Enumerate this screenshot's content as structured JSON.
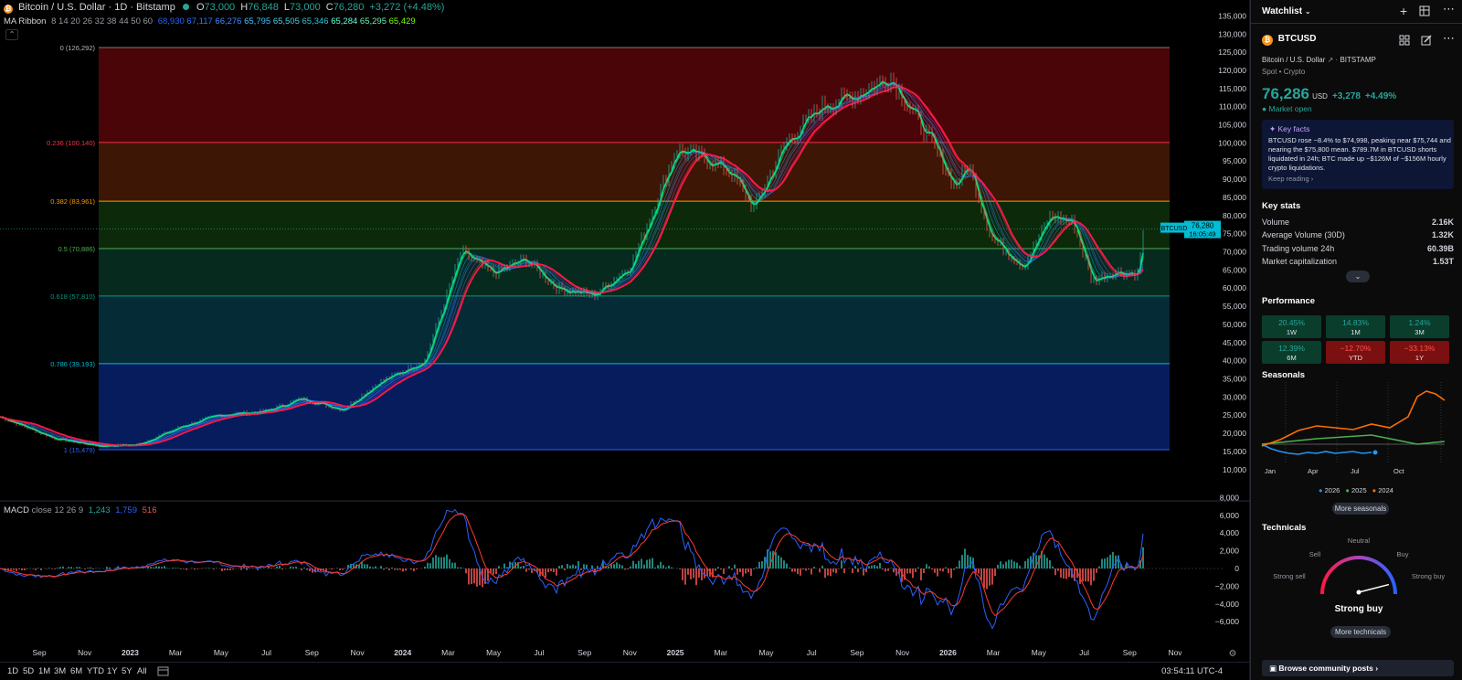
{
  "header": {
    "symbol_title": "Bitcoin / U.S. Dollar · 1D · Bitstamp",
    "ohlc": [
      {
        "label": "O",
        "value": "73,000"
      },
      {
        "label": "H",
        "value": "76,848"
      },
      {
        "label": "L",
        "value": "73,000"
      },
      {
        "label": "C",
        "value": "76,280"
      }
    ],
    "change": "+3,272 (+4.48%)",
    "ma_label": "MA Ribbon",
    "ma_params": "8 14 20 26 32 38 44 50 60",
    "ma_values": [
      "68,930",
      "67,117",
      "66,276",
      "65,795",
      "65,505",
      "65,346",
      "65,284",
      "65,295",
      "65,429"
    ],
    "collapse_glyph": "⌃"
  },
  "chart": {
    "price_axis": [
      "135,000",
      "130,000",
      "125,000",
      "120,000",
      "115,000",
      "110,000",
      "105,000",
      "100,000",
      "95,000",
      "90,000",
      "85,000",
      "80,000",
      "75,000",
      "70,000",
      "65,000",
      "60,000",
      "55,000",
      "50,000",
      "45,000",
      "40,000",
      "35,000",
      "30,000",
      "25,000",
      "20,000",
      "15,000",
      "10,000"
    ],
    "macd_axis": [
      "8,000",
      "6,000",
      "4,000",
      "2,000",
      "0",
      "−2,000",
      "−4,000",
      "−6,000"
    ],
    "time_axis": [
      "Sep",
      "Nov",
      "2023",
      "Mar",
      "May",
      "Jul",
      "Sep",
      "Nov",
      "2024",
      "Mar",
      "May",
      "Jul",
      "Sep",
      "Nov",
      "2025",
      "Mar",
      "May",
      "Jul",
      "Sep",
      "Nov",
      "2026",
      "Mar",
      "May",
      "Jul",
      "Sep",
      "Nov"
    ],
    "fib_levels": [
      {
        "ratio": "0",
        "price": 126292,
        "label": "0 (126,292)",
        "line_color": "#787b86",
        "label_color": "#b2b5be",
        "fill": "#4a0508"
      },
      {
        "ratio": "0.236",
        "price": 100140,
        "label": "0.236 (100,140)",
        "line_color": "#f23645",
        "label_color": "#f23645",
        "fill": "#3d1605"
      },
      {
        "ratio": "0.382",
        "price": 83961,
        "label": "0.382 (83,961)",
        "line_color": "#ff9800",
        "label_color": "#ff9800",
        "fill": "#0c2a0a"
      },
      {
        "ratio": "0.5",
        "price": 70886,
        "label": "0.5 (70,886)",
        "line_color": "#4caf50",
        "label_color": "#4caf50",
        "fill": "#062a1e"
      },
      {
        "ratio": "0.618",
        "price": 57810,
        "label": "0.618 (57,810)",
        "line_color": "#089981",
        "label_color": "#089981",
        "fill": "#052b36"
      },
      {
        "ratio": "0.786",
        "price": 39193,
        "label": "0.786 (39,193)",
        "line_color": "#00bcd4",
        "label_color": "#00bcd4",
        "fill": "#061c5c"
      },
      {
        "ratio": "1",
        "price": 15479,
        "label": "1 (15,479)",
        "line_color": "#2962ff",
        "label_color": "#2962ff",
        "fill": ""
      }
    ],
    "price_tag": {
      "symbol": "BTCUSD",
      "price": "76,280",
      "countdown": "16:05:49"
    },
    "colors": {
      "up": "#26a69a",
      "down": "#ef5350",
      "ma_fast": "#00e676",
      "ma_slow": "#ff1744",
      "macd": "#2962ff",
      "signal": "#ff3b30"
    }
  },
  "macd": {
    "label": "MACD",
    "params": "close 12 26 9",
    "values": [
      "1,243",
      "1,759",
      "516"
    ]
  },
  "bottom_bar": {
    "ranges": [
      "1D",
      "5D",
      "1M",
      "3M",
      "6M",
      "YTD",
      "1Y",
      "5Y",
      "All"
    ],
    "clock": "03:54:11 UTC-4"
  },
  "panel": {
    "watchlist_label": "Watchlist",
    "symbol": "BTCUSD",
    "full_name": "Bitcoin / U.S. Dollar",
    "exchange": "BITSTAMP",
    "type": "Spot • Crypto",
    "price": "76,286",
    "currency": "USD",
    "change": "+3,278",
    "change_pct": "+4.49%",
    "market_status": "Market open",
    "key_facts_title": "Key facts",
    "key_facts_lines": [
      "BTCUSD rose ~8.4% to $74,998, peaking near $75,744 and",
      "nearing the $75,800 mean. $789.7M in BTCUSD shorts",
      "liquidated in 24h; BTC made up ~$126M of ~$156M hourly",
      "crypto liquidations."
    ],
    "keep_reading": "Keep reading ›",
    "key_stats_title": "Key stats",
    "key_stats": [
      {
        "label": "Volume",
        "value": "2.16K"
      },
      {
        "label": "Average Volume (30D)",
        "value": "1.32K"
      },
      {
        "label": "Trading volume 24h",
        "value": "60.39B"
      },
      {
        "label": "Market capitalization",
        "value": "1.53T"
      }
    ],
    "performance_title": "Performance",
    "performance": [
      {
        "value": "20.45%",
        "label": "1W",
        "trend": "up"
      },
      {
        "value": "14.83%",
        "label": "1M",
        "trend": "up"
      },
      {
        "value": "1.24%",
        "label": "3M",
        "trend": "up"
      },
      {
        "value": "12.39%",
        "label": "6M",
        "trend": "up"
      },
      {
        "value": "−12.70%",
        "label": "YTD",
        "trend": "down"
      },
      {
        "value": "−33.13%",
        "label": "1Y",
        "trend": "down"
      }
    ],
    "seasonals_title": "Seasonals",
    "seasonal_months": [
      "Jan",
      "Apr",
      "Jul",
      "Oct"
    ],
    "seasonal_years": [
      {
        "year": "2026",
        "color": "#2196f3"
      },
      {
        "year": "2025",
        "color": "#4caf50"
      },
      {
        "year": "2024",
        "color": "#ff6d00"
      }
    ],
    "more_seasonals": "More seasonals",
    "technicals_title": "Technicals",
    "gauge_labels": {
      "neutral": "Neutral",
      "sell": "Sell",
      "buy": "Buy",
      "strong_sell": "Strong sell",
      "strong_buy": "Strong buy"
    },
    "gauge_reading": "Strong buy",
    "gauge_value": 0.92,
    "more_technicals": "More technicals",
    "community": "Browse community posts ›"
  }
}
